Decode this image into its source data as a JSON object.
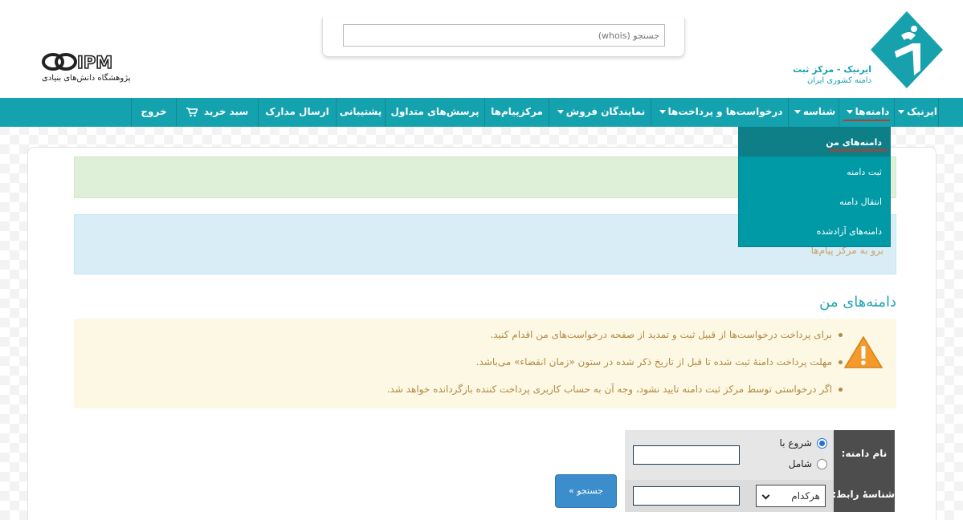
{
  "header": {
    "brand_name": "ایرنیک - مرکز ثبت",
    "brand_subtitle": "دامنه کشوری ایران",
    "whois_placeholder": "جستجو (whois)",
    "ipm_logo_text": "IPM",
    "ipm_subtitle": "پژوهشگاه دانش‌های بنیادی",
    "brand_color": "#15a2af"
  },
  "nav": {
    "items": [
      {
        "label": "ایرنیک",
        "has_caret": true
      },
      {
        "label": "دامنه‌ها",
        "has_caret": true,
        "active": true
      },
      {
        "label": "شناسه",
        "has_caret": true
      },
      {
        "label": "درخواست‌ها و پرداخت‌ها",
        "has_caret": true
      },
      {
        "label": "نمایندگان فروش",
        "has_caret": true
      },
      {
        "label": "مرکزپیام‌ها",
        "has_caret": false
      },
      {
        "label": "پرسش‌های متداول",
        "has_caret": false
      },
      {
        "label": "پشتیبانی",
        "has_caret": false
      },
      {
        "label": "ارسال مدارک",
        "has_caret": false
      },
      {
        "label": "سبد خرید",
        "has_caret": false,
        "icon": "cart-icon"
      },
      {
        "label": "خروج",
        "has_caret": false
      }
    ]
  },
  "dropdown": {
    "items": [
      {
        "label": "دامنه‌های من",
        "active": true
      },
      {
        "label": "ثبت دامنه"
      },
      {
        "label": "انتقال دامنه"
      },
      {
        "label": "دامنه‌های آزادشده"
      }
    ]
  },
  "alerts": {
    "info_link": "برو به مرکز پیام‌ها"
  },
  "section": {
    "title": "دامنه‌های من",
    "warning_icon": "warning-icon",
    "bullets": [
      "برای پرداخت درخواست‌ها از قبیل ثبت و تمدید از صفحه درخواست‌های من اقدام کنید.",
      "مهلت پرداخت دامنهٔ ثبت شده تا قبل از تاریخ ذکر شده در ستون «زمان انقضاء» می‌باشد.",
      "اگر درخواستی توسط مرکز ثبت دامنه تایید نشود، وجه آن به حساب کاربری پرداخت کننده بازگردانده خواهد شد."
    ]
  },
  "form": {
    "domain_label": "نام دامنه:",
    "radio_starts_with": "شروع با",
    "radio_contains": "شامل",
    "radio_selected": "شروع با",
    "domain_value": "",
    "contact_label": "شناسهٔ رابط:",
    "contact_select_value": "هرکدام",
    "contact_value": "",
    "search_button": "جستجو »"
  }
}
